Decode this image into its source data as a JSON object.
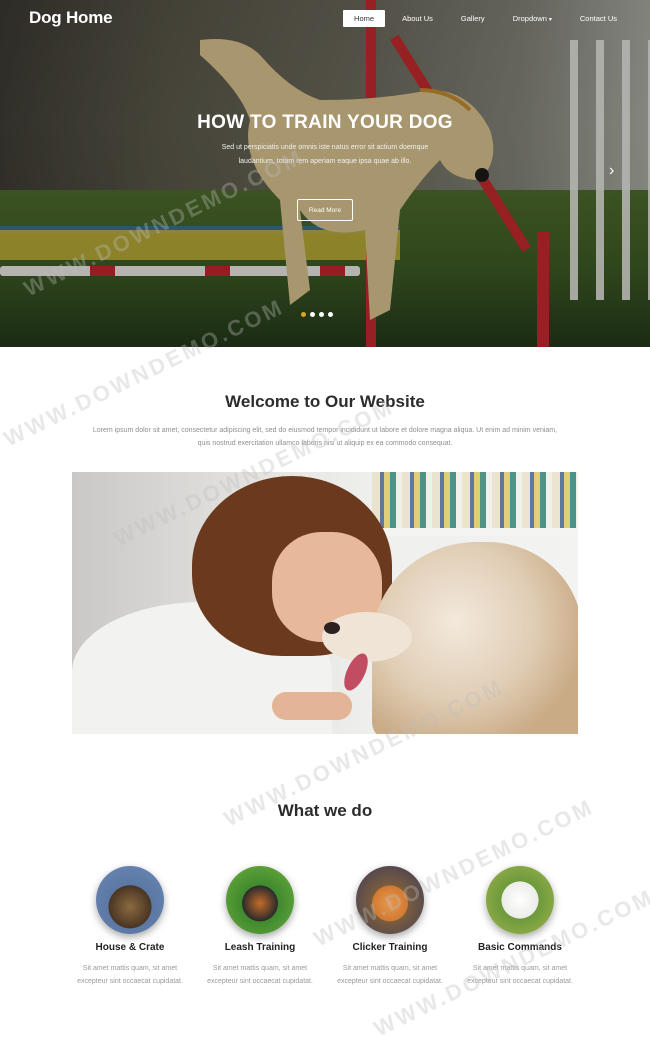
{
  "brand": "Dog Home",
  "nav": {
    "items": [
      {
        "label": "Home",
        "active": true
      },
      {
        "label": "About Us",
        "active": false
      },
      {
        "label": "Gallery",
        "active": false
      },
      {
        "label": "Dropdown",
        "active": false
      },
      {
        "label": "Contact Us",
        "active": false
      }
    ]
  },
  "hero": {
    "title": "HOW TO TRAIN YOUR DOG",
    "subtitle": "Sed ut perspiciatis unde omnis iste natus error sit actium doemque laudantium, totam rem aperiam eaque ipsa quae ab illo.",
    "button": "Read More",
    "slides": 4,
    "active_slide": 1,
    "next_icon": "chevron-right-icon"
  },
  "welcome": {
    "title": "Welcome to Our Website",
    "text": "Lorem ipsum dolor sit amet, consectetur adipiscing elit, sed do eiusmod tempor incididunt ut labore et dolore magna aliqua. Ut enim ad minim veniam, quis nostrud exercitation ullamco laboris nisi ut aliquip ex ea commodo consequat."
  },
  "services": {
    "title": "What we do",
    "items": [
      {
        "name": "House & Crate",
        "text": "Sit amet mattis quam, sit amet excepteur sint occaecat cupidatat."
      },
      {
        "name": "Leash Training",
        "text": "Sit amet mattis quam, sit amet excepteur sint occaecat cupidatat."
      },
      {
        "name": "Clicker Training",
        "text": "Sit amet mattis quam, sit amet excepteur sint occaecat cupidatat."
      },
      {
        "name": "Basic Commands",
        "text": "Sit amet mattis quam, sit amet excepteur sint occaecat cupidatat."
      }
    ]
  },
  "watermark": "WWW.DOWNDEMO.COM",
  "colors": {
    "accent": "#e0a21d",
    "hero_red": "#c02a2e"
  }
}
